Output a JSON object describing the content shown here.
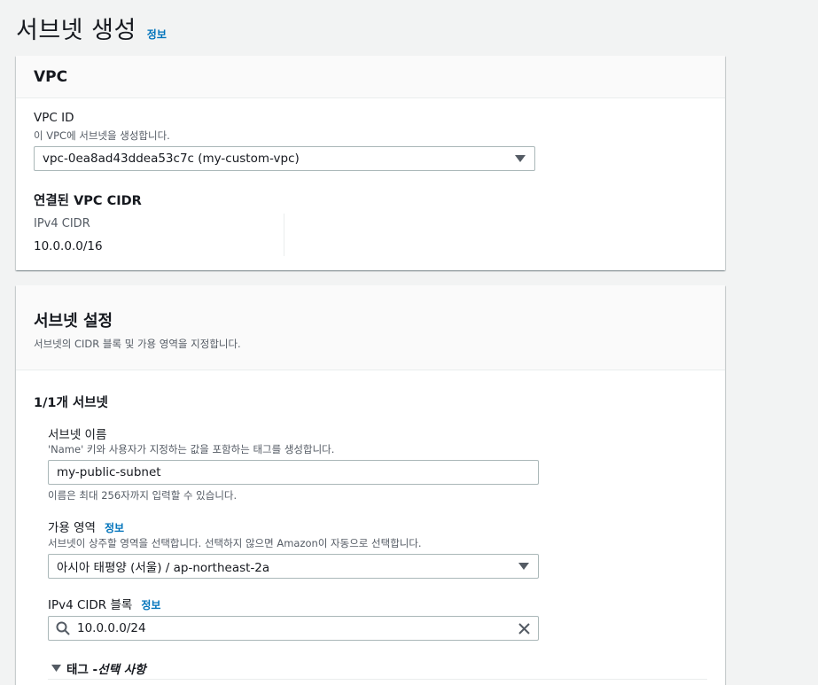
{
  "page": {
    "title": "서브넷 생성",
    "info": "정보"
  },
  "vpc_section": {
    "header": "VPC",
    "vpc_id_label": "VPC ID",
    "vpc_id_desc": "이 VPC에 서브넷을 생성합니다.",
    "vpc_id_value": "vpc-0ea8ad43ddea53c7c (my-custom-vpc)",
    "cidr_heading": "연결된 VPC CIDR",
    "ipv4_cidr_label": "IPv4 CIDR",
    "ipv4_cidr_value": "10.0.0.0/16"
  },
  "subnet_section": {
    "header": "서브넷 설정",
    "desc": "서브넷의 CIDR 블록 및 가용 영역을 지정합니다.",
    "count_heading": "1/1개 서브넷",
    "name_label": "서브넷 이름",
    "name_desc": "'Name' 키와 사용자가 지정하는 값을 포함하는 태그를 생성합니다.",
    "name_value": "my-public-subnet",
    "name_hint": "이름은 최대 256자까지 입력할 수 있습니다.",
    "az_label": "가용 영역",
    "az_info": "정보",
    "az_desc": "서브넷이 상주할 영역을 선택합니다. 선택하지 않으면 Amazon이 자동으로 선택합니다.",
    "az_value": "아시아 태평양 (서울) / ap-northeast-2a",
    "cidr_block_label": "IPv4 CIDR 블록",
    "cidr_block_info": "정보",
    "cidr_block_value": "10.0.0.0/24",
    "tags_label": "태그 - ",
    "tags_optional": "선택 사항"
  },
  "icons": {
    "search": "search-icon",
    "clear": "close-icon",
    "caret": "caret-down-icon",
    "expand": "triangle-down-icon"
  }
}
